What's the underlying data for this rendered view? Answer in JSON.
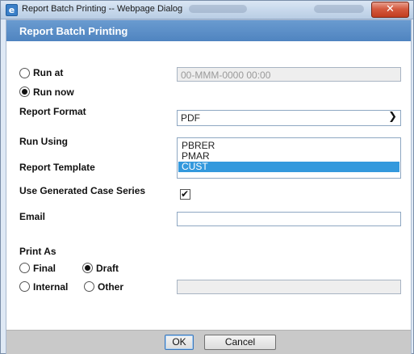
{
  "window": {
    "title": "Report Batch Printing -- Webpage Dialog",
    "close_glyph": "✕",
    "icon": "ie-page-icon"
  },
  "dialog": {
    "header": "Report Batch Printing"
  },
  "run_options": {
    "run_at_label": "Run at",
    "run_at_placeholder": "00-MMM-0000 00:00",
    "run_now_label": "Run now",
    "selected": "Run now"
  },
  "report_format": {
    "label": "Report Format",
    "value": "PDF"
  },
  "run_using": {
    "label": "Run Using",
    "options": [
      "PBRER",
      "PMAR",
      "CUST"
    ],
    "selected": "CUST"
  },
  "report_template": {
    "label": "Report Template"
  },
  "use_generated_case_series": {
    "label": "Use Generated Case Series",
    "checked": true
  },
  "email": {
    "label": "Email",
    "value": ""
  },
  "print_as": {
    "label": "Print As",
    "final_label": "Final",
    "draft_label": "Draft",
    "internal_label": "Internal",
    "other_label": "Other",
    "selected": "Draft",
    "other_value": ""
  },
  "buttons": {
    "ok": "OK",
    "cancel": "Cancel"
  },
  "colors": {
    "header_bg": "#5a8dc8",
    "selection": "#3399dd",
    "footer_bg": "#c9c9c9"
  }
}
